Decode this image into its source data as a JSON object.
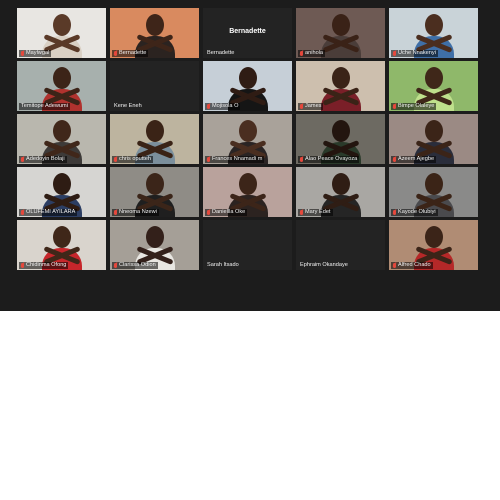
{
  "participants": [
    {
      "name": "Maylwgal",
      "video": true,
      "muted": true,
      "bg": "#e8e6e2",
      "skin": "#5a3a28",
      "shirt": "#d9d0c4",
      "arms": "#5a3a28"
    },
    {
      "name": "Bernadette",
      "video": true,
      "muted": true,
      "bg": "#d98a5f",
      "skin": "#3e2519",
      "shirt": "#2b2320",
      "arms": "#3e2519"
    },
    {
      "name": "Bernadette",
      "video": false,
      "muted": false,
      "center": "Bernadette"
    },
    {
      "name": "anihola",
      "video": true,
      "muted": true,
      "bg": "#6e5a54",
      "skin": "#3a2217",
      "shirt": "#4a3d39",
      "arms": "#3a2217"
    },
    {
      "name": "Uche Nnakenyi",
      "video": true,
      "muted": true,
      "bg": "#c9d3d8",
      "skin": "#4b2e1f",
      "shirt": "#3f6fa7",
      "arms": "#4b2e1f"
    },
    {
      "name": "Temitope Adewumi",
      "video": true,
      "muted": false,
      "active": true,
      "bg": "#a7b0ad",
      "skin": "#3c2418",
      "shirt": "#b0322e",
      "arms": "#3c2418"
    },
    {
      "name": "Kene Eneh",
      "video": false,
      "muted": false
    },
    {
      "name": "Mojisola O",
      "video": true,
      "muted": true,
      "bg": "#c6cfd7",
      "skin": "#2f1c14",
      "shirt": "#151515",
      "arms": "#2f1c14"
    },
    {
      "name": "James",
      "video": true,
      "muted": true,
      "bg": "#cdbfae",
      "skin": "#3a2317",
      "shirt": "#7a1f28",
      "arms": "#3a2317"
    },
    {
      "name": "Bimpe Olaleye",
      "video": true,
      "muted": true,
      "bg": "#8fb86a",
      "skin": "#3f2719",
      "shirt": "#bfe08c",
      "arms": "#3f2719"
    },
    {
      "name": "Adedoyin Bolaji",
      "video": true,
      "muted": true,
      "bg": "#b9b7ae",
      "skin": "#40271a",
      "shirt": "#3d3a38",
      "arms": "#40271a"
    },
    {
      "name": "chris oputteh",
      "video": true,
      "muted": true,
      "bg": "#bdb49f",
      "skin": "#3a2316",
      "shirt": "#7b8f9c",
      "arms": "#3a2316"
    },
    {
      "name": "Frances Nnamadi m",
      "video": true,
      "muted": true,
      "bg": "#a9a29a",
      "skin": "#4a2e20",
      "shirt": "#2a2424",
      "arms": "#4a2e20"
    },
    {
      "name": "Alao Peace Ovayoza",
      "video": true,
      "muted": true,
      "bg": "#6d6a62",
      "skin": "#23150f",
      "shirt": "#2a3a2a",
      "arms": "#23150f"
    },
    {
      "name": "Azeem Ajegbe",
      "video": true,
      "muted": true,
      "bg": "#9b8a84",
      "skin": "#3b2418",
      "shirt": "#2a2d3b",
      "arms": "#3b2418"
    },
    {
      "name": "OLUFEMI AYILARA",
      "video": true,
      "muted": true,
      "bg": "#d6d5d2",
      "skin": "#2e1c13",
      "shirt": "#2c3e63",
      "arms": "#2e1c13"
    },
    {
      "name": "Nneoma Nzewi",
      "video": true,
      "muted": true,
      "bg": "#8f8c86",
      "skin": "#3b2519",
      "shirt": "#1f1f1f",
      "arms": "#3b2519"
    },
    {
      "name": "Daniellla Oke",
      "video": true,
      "muted": true,
      "bg": "#b9a29c",
      "skin": "#3c2519",
      "shirt": "#2c2320",
      "arms": "#3c2519"
    },
    {
      "name": "Mary Edet",
      "video": true,
      "muted": true,
      "bg": "#a9a7a3",
      "skin": "#2f1d14",
      "shirt": "#252525",
      "arms": "#2f1d14"
    },
    {
      "name": "Kayode Olubiyi",
      "video": true,
      "muted": true,
      "bg": "#8a8a89",
      "skin": "#3b2417",
      "shirt": "#4a4a4d",
      "arms": "#3b2417"
    },
    {
      "name": "Chidinma Ofong",
      "video": true,
      "muted": true,
      "bg": "#d9d4cd",
      "skin": "#3f2719",
      "shirt": "#c6262b",
      "arms": "#3f2719"
    },
    {
      "name": "Clarissa Odion",
      "video": true,
      "muted": true,
      "bg": "#a59f97",
      "skin": "#33201a",
      "shirt": "#e8e6e1",
      "arms": "#33201a"
    },
    {
      "name": "Sarah Itsado",
      "video": false,
      "muted": false
    },
    {
      "name": "Ephraim Okandaye",
      "video": false,
      "muted": false
    },
    {
      "name": "Alfred Chado",
      "video": true,
      "muted": true,
      "bg": "#b08c74",
      "skin": "#3b2418",
      "shirt": "#b52828",
      "arms": "#3b2418"
    }
  ]
}
